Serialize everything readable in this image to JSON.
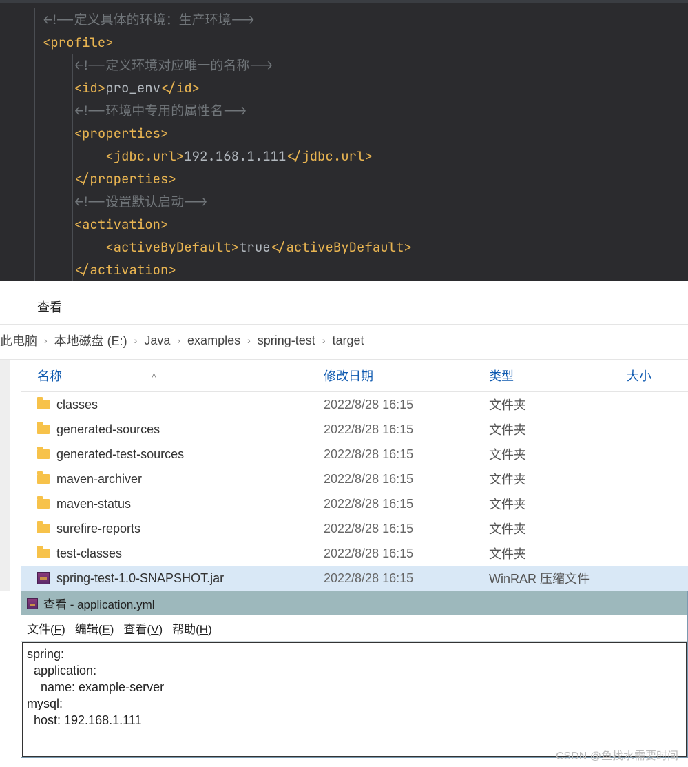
{
  "editor": {
    "lines": [
      {
        "indent": 0,
        "type": "comment",
        "text": "<!--定义具体的环境：生产环境-->"
      },
      {
        "indent": 0,
        "type": "tag-open",
        "tag": "profile"
      },
      {
        "indent": 1,
        "type": "comment",
        "text": "<!--定义环境对应唯一的名称-->"
      },
      {
        "indent": 1,
        "type": "tag-pair",
        "tag": "id",
        "value": "pro_env"
      },
      {
        "indent": 1,
        "type": "comment",
        "text": "<!--环境中专用的属性名-->"
      },
      {
        "indent": 1,
        "type": "tag-open",
        "tag": "properties"
      },
      {
        "indent": 2,
        "type": "tag-pair",
        "tag": "jdbc.url",
        "value": "192.168.1.111"
      },
      {
        "indent": 1,
        "type": "tag-close",
        "tag": "properties"
      },
      {
        "indent": 1,
        "type": "comment",
        "text": "<!--设置默认启动-->"
      },
      {
        "indent": 1,
        "type": "tag-open",
        "tag": "activation"
      },
      {
        "indent": 2,
        "type": "tag-pair",
        "tag": "activeByDefault",
        "value": "true"
      },
      {
        "indent": 1,
        "type": "tag-close",
        "tag": "activation"
      }
    ]
  },
  "explorer": {
    "toolbar": {
      "view": "查看"
    },
    "breadcrumb": [
      "此电脑",
      "本地磁盘 (E:)",
      "Java",
      "examples",
      "spring-test",
      "target"
    ],
    "columns": {
      "name": "名称",
      "date": "修改日期",
      "type": "类型",
      "size": "大小"
    },
    "rows": [
      {
        "icon": "folder",
        "name": "classes",
        "date": "2022/8/28 16:15",
        "type": "文件夹"
      },
      {
        "icon": "folder",
        "name": "generated-sources",
        "date": "2022/8/28 16:15",
        "type": "文件夹"
      },
      {
        "icon": "folder",
        "name": "generated-test-sources",
        "date": "2022/8/28 16:15",
        "type": "文件夹"
      },
      {
        "icon": "folder",
        "name": "maven-archiver",
        "date": "2022/8/28 16:15",
        "type": "文件夹"
      },
      {
        "icon": "folder",
        "name": "maven-status",
        "date": "2022/8/28 16:15",
        "type": "文件夹"
      },
      {
        "icon": "folder",
        "name": "surefire-reports",
        "date": "2022/8/28 16:15",
        "type": "文件夹"
      },
      {
        "icon": "folder",
        "name": "test-classes",
        "date": "2022/8/28 16:15",
        "type": "文件夹"
      },
      {
        "icon": "rar",
        "name": "spring-test-1.0-SNAPSHOT.jar",
        "date": "2022/8/28 16:15",
        "type": "WinRAR 压缩文件",
        "selected": true
      }
    ]
  },
  "viewer": {
    "title": "查看 - application.yml",
    "menu": {
      "file": "文件(F)",
      "edit": "编辑(E)",
      "view": "查看(V)",
      "help": "帮助(H)"
    },
    "content": "spring:\n  application:\n    name: example-server\nmysql:\n  host: 192.168.1.111"
  },
  "watermark": "CSDN @鱼找水需要时间"
}
